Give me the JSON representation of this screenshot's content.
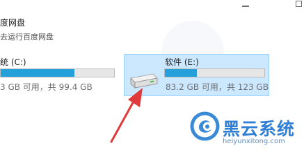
{
  "baidu": {
    "title": "度网盘",
    "subtitle": "去运行百度网盘"
  },
  "drives": {
    "c": {
      "name": "统 (C:)",
      "free_text": "3 GB 可用，共 99.4 GB",
      "used_fraction": 0.65
    },
    "e": {
      "name": "软件 (E:)",
      "free_text": "83.2 GB 可用，共 123 GB",
      "used_fraction": 0.32,
      "icon": "drive-icon",
      "selected": true
    }
  },
  "watermark": {
    "brand": "黑云系统",
    "url": "heiyunxitong.com",
    "icon": "logo-icon"
  },
  "colors": {
    "accent": "#26a0da",
    "selection_bg": "#cce8ff",
    "selection_border": "#99d1ff",
    "arrow": "#e03a3a",
    "brand": "#2f7fd5"
  }
}
